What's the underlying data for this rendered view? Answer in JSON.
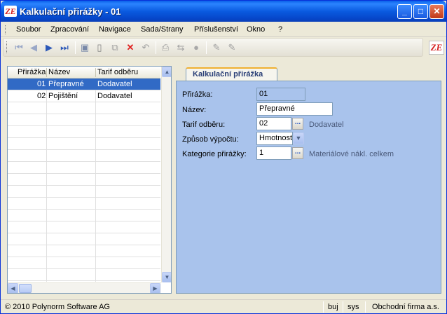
{
  "window": {
    "title": "Kalkulační přirážky - 01",
    "app_icon_text": "ZE",
    "controls": {
      "minimize": "_",
      "maximize": "□",
      "close": "✕"
    }
  },
  "menu": [
    "Soubor",
    "Zpracování",
    "Navigace",
    "Sada/Strany",
    "Příslušenství",
    "Okno",
    "?"
  ],
  "toolbar": {
    "icons": [
      "first-record-icon",
      "previous-record-icon",
      "next-record-icon",
      "last-record-icon",
      "save-icon",
      "new-record-icon",
      "copy-record-icon",
      "delete-icon",
      "undo-icon",
      "print-icon",
      "link-icon",
      "filter-icon",
      "edit-icon",
      "edit-alt-icon"
    ],
    "brand_logo_text": "ZE"
  },
  "grid": {
    "columns": [
      "Přirážka",
      "Název",
      "Tarif odběru"
    ],
    "rows": [
      {
        "code": "01",
        "name": "Přepravné",
        "tariff": "Dodavatel",
        "selected": true
      },
      {
        "code": "02",
        "name": "Pojištění",
        "tariff": "Dodavatel",
        "selected": false
      }
    ]
  },
  "detail": {
    "tab_label": "Kalkulační přirážka",
    "fields": {
      "code": {
        "label": "Přirážka:",
        "value": "01"
      },
      "name": {
        "label": "Název:",
        "value": "Přepravné"
      },
      "tariff": {
        "label": "Tarif odběru:",
        "value": "02",
        "hint": "Dodavatel"
      },
      "method": {
        "label": "Způsob výpočtu:",
        "value": "Hmotnost"
      },
      "category": {
        "label": "Kategorie přirážky:",
        "value": "1",
        "hint": "Materiálové nákl. celkem"
      }
    },
    "ellipsis": "..."
  },
  "status": {
    "copyright": "© 2010 Polynorm Software AG",
    "user": "buj",
    "system": "sys",
    "company": "Obchodní firma a.s."
  }
}
